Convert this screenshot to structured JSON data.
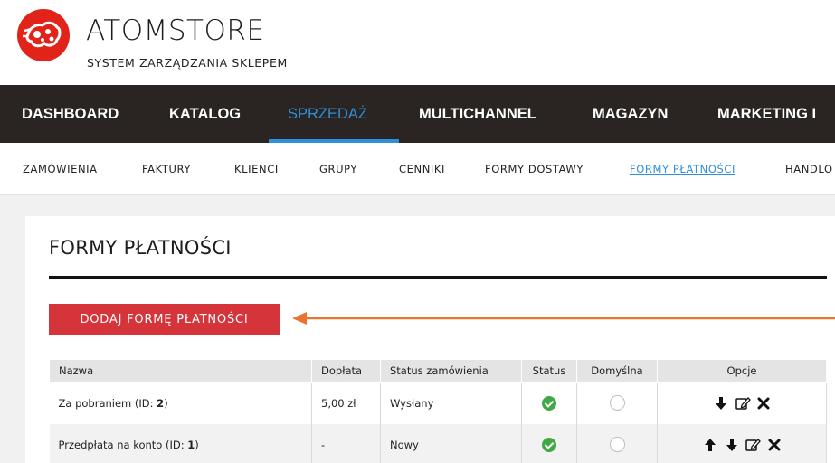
{
  "brand": {
    "name": "ATOMSTORE",
    "subtitle": "SYSTEM ZARZĄDZANIA SKLEPEM",
    "logo_color": "#e2231a"
  },
  "main_nav": {
    "items": [
      {
        "label": "DASHBOARD"
      },
      {
        "label": "KATALOG"
      },
      {
        "label": "SPRZEDAŻ",
        "active": true
      },
      {
        "label": "MULTICHANNEL"
      },
      {
        "label": "MAGAZYN"
      },
      {
        "label": "MARKETING I"
      }
    ],
    "bg_color": "#2a2422",
    "active_color": "#2f8fd8"
  },
  "sub_nav": {
    "items": [
      {
        "label": "ZAMÓWIENIA"
      },
      {
        "label": "FAKTURY"
      },
      {
        "label": "KLIENCI"
      },
      {
        "label": "GRUPY"
      },
      {
        "label": "CENNIKI"
      },
      {
        "label": "FORMY DOSTAWY"
      },
      {
        "label": "FORMY PŁATNOŚCI",
        "active": true
      },
      {
        "label": "HANDLO"
      }
    ]
  },
  "page": {
    "title": "FORMY PŁATNOŚCI",
    "add_button_label": "DODAJ FORMĘ PŁATNOŚCI",
    "add_button_color": "#d4343a",
    "annotation_arrow_color": "#e8742f"
  },
  "table": {
    "headers": {
      "name": "Nazwa",
      "surcharge": "Dopłata",
      "order_status": "Status zamówienia",
      "status": "Status",
      "default": "Domyślna",
      "options": "Opcje"
    },
    "rows": [
      {
        "name_prefix": "Za pobraniem (ID: ",
        "id": "2",
        "name_suffix": ")",
        "surcharge": "5,00 zł",
        "order_status": "Wysłany",
        "status_icon": "check-circle-icon",
        "default_icon": "radio-unchecked-icon",
        "options": [
          "arrow-down-icon",
          "edit-icon",
          "delete-icon"
        ]
      },
      {
        "name_prefix": "Przedpłata na konto (ID: ",
        "id": "1",
        "name_suffix": ")",
        "surcharge": "-",
        "order_status": "Nowy",
        "status_icon": "check-circle-icon",
        "default_icon": "radio-unchecked-icon",
        "options": [
          "arrow-up-icon",
          "arrow-down-icon",
          "edit-icon",
          "delete-icon"
        ]
      }
    ]
  }
}
